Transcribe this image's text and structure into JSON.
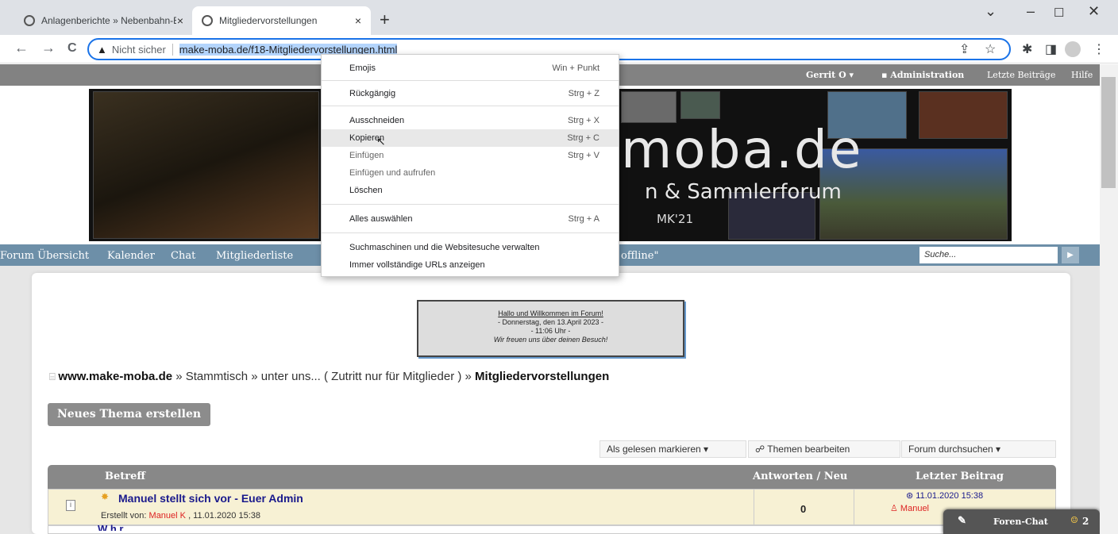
{
  "browser": {
    "tabs": [
      {
        "title": "Anlagenberichte » Nebenbahn-E",
        "close": "×"
      },
      {
        "title": "Mitgliedervorstellungen",
        "close": "×"
      }
    ],
    "new_tab": "+",
    "window_controls": {
      "chevron": "⌄",
      "minimize": "–",
      "maximize": "☐",
      "close": "✕"
    },
    "nav": {
      "back": "←",
      "forward": "→",
      "reload": "C"
    },
    "omnibox": {
      "warning_icon": "▲",
      "security_label": "Nicht sicher",
      "url": "make-moba.de/f18-Mitgliedervorstellungen.html"
    },
    "toolbar_icons": [
      "share-icon",
      "star-icon",
      "extensions-icon",
      "sidepanel-icon",
      "profile-icon",
      "menu-icon"
    ]
  },
  "site": {
    "top_links": {
      "user": "Gerrit O ▾",
      "admin": "Administration",
      "latest": "Letzte Beiträge",
      "help": "Hilfe"
    },
    "banner": {
      "logo_text": "moba.de",
      "sub_text": "n & Sammlerforum",
      "mk": "MK'21"
    },
    "nav": [
      "Forum Übersicht",
      "Kalender",
      "Chat",
      "Mitgliederliste"
    ],
    "nav_hidden_tail": "offline\"",
    "search_placeholder": "Suche...",
    "welcome": {
      "line1": "Hallo und Willkommen im Forum!",
      "line2": "- Donnerstag, den 13.April 2023 -",
      "line3": "- 11:06 Uhr -",
      "line4": "Wir freuen uns über deinen Besuch!"
    },
    "breadcrumb": {
      "home": "www.make-moba.de",
      "middle": " » Stammtisch » unter uns... ( Zutritt nur für Mitglieder ) » ",
      "current": "Mitgliedervorstellungen"
    },
    "new_topic": "Neues Thema erstellen",
    "tools": [
      "Als gelesen markieren ▾",
      "Themen bearbeiten",
      "Forum durchsuchen ▾"
    ],
    "table": {
      "headers": {
        "subject": "Betreff",
        "replies": "Antworten / Neu",
        "last": "Letzter Beitrag"
      },
      "rows": [
        {
          "title": "Manuel stellt sich vor - Euer Admin",
          "created_prefix": "Erstellt von: ",
          "author": "Manuel K",
          "created_date": " , 11.01.2020 15:38",
          "replies": "0",
          "last_date": "11.01.2020 15:38",
          "last_author": "Manuel"
        }
      ],
      "row2_partial": "W   h   r   "
    },
    "chat": {
      "label": "Foren-Chat",
      "count": "2"
    }
  },
  "context_menu": {
    "items": [
      {
        "label": "Emojis",
        "shortcut": "Win + Punkt",
        "enabled": true
      },
      {
        "label": "Rückgängig",
        "shortcut": "Strg + Z",
        "enabled": true
      },
      {
        "label": "Ausschneiden",
        "shortcut": "Strg + X",
        "enabled": true
      },
      {
        "label": "Kopieren",
        "shortcut": "Strg + C",
        "enabled": true
      },
      {
        "label": "Einfügen",
        "shortcut": "Strg + V",
        "enabled": false
      },
      {
        "label": "Einfügen und aufrufen",
        "shortcut": "",
        "enabled": false
      },
      {
        "label": "Löschen",
        "shortcut": "",
        "enabled": true
      },
      {
        "label": "Alles auswählen",
        "shortcut": "Strg + A",
        "enabled": true
      },
      {
        "label": "Suchmaschinen und die Websitesuche verwalten",
        "shortcut": "",
        "enabled": true
      },
      {
        "label": "Immer vollständige URLs anzeigen",
        "shortcut": "",
        "enabled": true
      }
    ]
  },
  "colors": {
    "accent": "#1a73e8",
    "nav": "#6d8fa8",
    "header_gray": "#828282",
    "row_highlight": "#f7f1d4",
    "link": "#1a1a8c",
    "author_red": "#d22"
  }
}
